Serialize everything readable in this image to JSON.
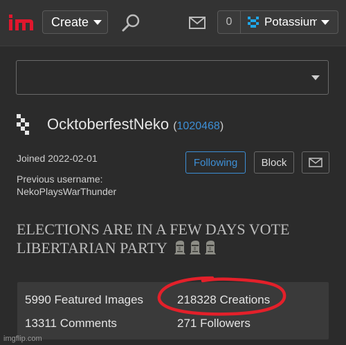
{
  "topbar": {
    "logo_text": "im",
    "create_label": "Create",
    "notification_count": "0",
    "username": "Potassium"
  },
  "profile": {
    "name": "OcktoberfestNeko",
    "id_open": "(",
    "id": "1020468",
    "id_close": ")",
    "joined": "Joined 2022-02-01",
    "previous_label": "Previous username:",
    "previous_name": "NekoPlaysWarThunder",
    "following_label": "Following",
    "block_label": "Block",
    "bio": "ELECTIONS ARE IN A FEW DAYS VOTE LIBERTARIAN PARTY"
  },
  "stats": {
    "featured": "5990 Featured Images",
    "creations": "218328 Creations",
    "comments": "13311 Comments",
    "followers": "271 Followers"
  },
  "watermark": "imgflip.com",
  "colors": {
    "accent": "#3d8fd6",
    "logo_red": "#e0172d",
    "annotation": "#e3202a",
    "avatar_blue": "#1fa6e8"
  },
  "icons": [
    "logo-icon",
    "search-icon",
    "mail-icon",
    "avatar-icon",
    "moai-emoji"
  ]
}
